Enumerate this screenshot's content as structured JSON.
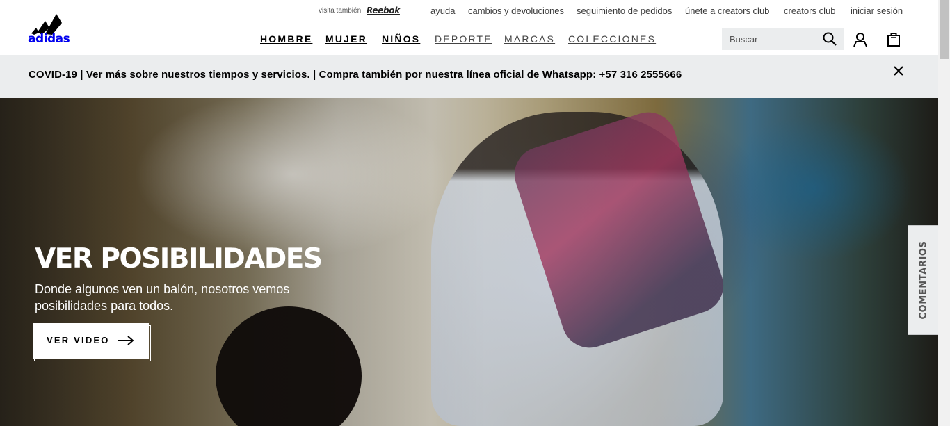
{
  "brand": {
    "logo_text": "adidas",
    "logo_icon": "adidas-performance-logo"
  },
  "util_bar": {
    "visita_label": "visita también",
    "reebok_label": "Reebok",
    "links": [
      "ayuda",
      "cambios y devoluciones",
      "seguimiento de pedidos",
      "únete a creators club",
      "creators club",
      "iniciar sesión"
    ]
  },
  "main_nav": {
    "items": [
      "HOMBRE",
      "MUJER",
      "NIÑOS",
      "DEPORTE",
      "MARCAS",
      "COLECCIONES"
    ]
  },
  "search": {
    "placeholder": "Buscar",
    "value": "",
    "icon": "search-icon"
  },
  "header_icons": {
    "account": "user-icon",
    "cart": "shopping-bag-icon"
  },
  "banner": {
    "text": "COVID-19 | Ver más sobre nuestros tiempos y servicios. | Compra también por nuestra línea oficial de Whatsapp: +57 316 2555666",
    "close_icon": "close-icon"
  },
  "hero": {
    "title": "VER POSIBILIDADES",
    "subtitle": "Donde algunos ven un balón, nosotros vemos posibilidades para todos.",
    "cta_label": "VER VIDEO",
    "cta_icon": "arrow-right-icon"
  },
  "feedback_tab": {
    "label": "COMENTARIOS"
  },
  "colors": {
    "text": "#000000",
    "banner_bg": "#ebedee",
    "search_bg": "#ebedee",
    "hero_text": "#ffffff"
  }
}
